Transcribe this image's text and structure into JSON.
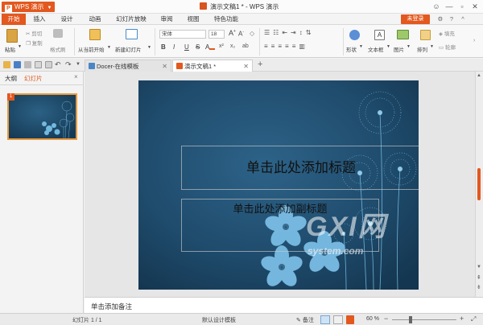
{
  "app": {
    "menu_label": "WPS 演示",
    "logo_letter": "P",
    "window_title": "演示文稿1 * - WPS 演示"
  },
  "menubar": {
    "items": [
      "开始",
      "插入",
      "设计",
      "动画",
      "幻灯片放映",
      "审阅",
      "视图",
      "特色功能"
    ],
    "login": "未登录"
  },
  "ribbon": {
    "paste": "粘贴",
    "cut": "剪切",
    "copy": "复制",
    "format_painter": "格式刷",
    "from_current": "从当前开始",
    "new_slide": "新建幻灯片",
    "font_name": "宋体",
    "font_size": "18",
    "bold": "B",
    "italic": "I",
    "underline": "U",
    "strike": "S",
    "grow_font": "A",
    "shrink_font": "A",
    "shape": "形状",
    "textbox": "文本框",
    "picture": "图片",
    "arrange": "排列",
    "fill": "填充",
    "outline": "轮廓"
  },
  "tabs": [
    {
      "label": "Docer-在线模板",
      "active": false
    },
    {
      "label": "演示文稿1 *",
      "active": true
    }
  ],
  "leftpane": {
    "tab_outline": "大纲",
    "tab_slides": "幻灯片",
    "thumb_number": "1"
  },
  "slide": {
    "title_placeholder": "单击此处添加标题",
    "subtitle_placeholder": "单击此处添加副标题",
    "watermark_main": "GXI网",
    "watermark_sub": "system.com"
  },
  "notes": {
    "placeholder": "单击添加备注"
  },
  "status": {
    "slide_counter": "幻灯片 1 / 1",
    "template": "默认设计模板",
    "notes_label": "备注",
    "zoom": "60 %"
  },
  "colors": {
    "accent": "#e2581f",
    "slide_bg": "#1e4a6b",
    "flower": "#7cc6ec"
  }
}
